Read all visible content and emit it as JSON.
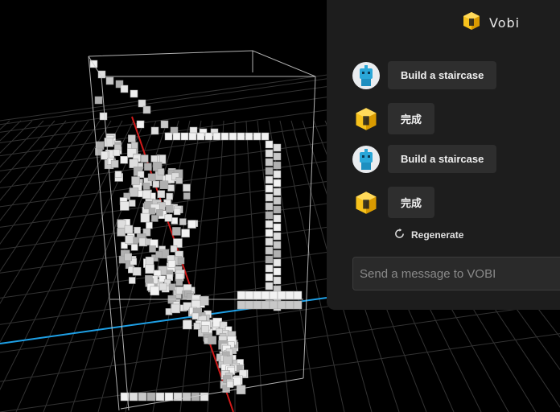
{
  "app": {
    "name": "Vobi"
  },
  "chat": {
    "messages": [
      {
        "role": "user",
        "text": "Build a staircase"
      },
      {
        "role": "bot",
        "text": "完成"
      },
      {
        "role": "user",
        "text": "Build a staircase"
      },
      {
        "role": "bot",
        "text": "完成"
      }
    ],
    "regenerate_label": "Regenerate",
    "input": {
      "placeholder": "Send a message to VOBI",
      "value": ""
    }
  },
  "icons": {
    "logo": "cube-logo-icon",
    "user_avatar": "robot-avatar-icon",
    "bot_avatar": "cube-bot-icon",
    "regenerate": "refresh-icon"
  },
  "colors": {
    "panel_bg": "#1d1d1d",
    "bubble_bg": "#2e2e2e",
    "logo_yellow": "#f7c21c",
    "axis_red": "#d11a1a",
    "axis_blue": "#1ea0e6",
    "grid": "#3a3a3a",
    "voxel": "#e6e6e6"
  }
}
